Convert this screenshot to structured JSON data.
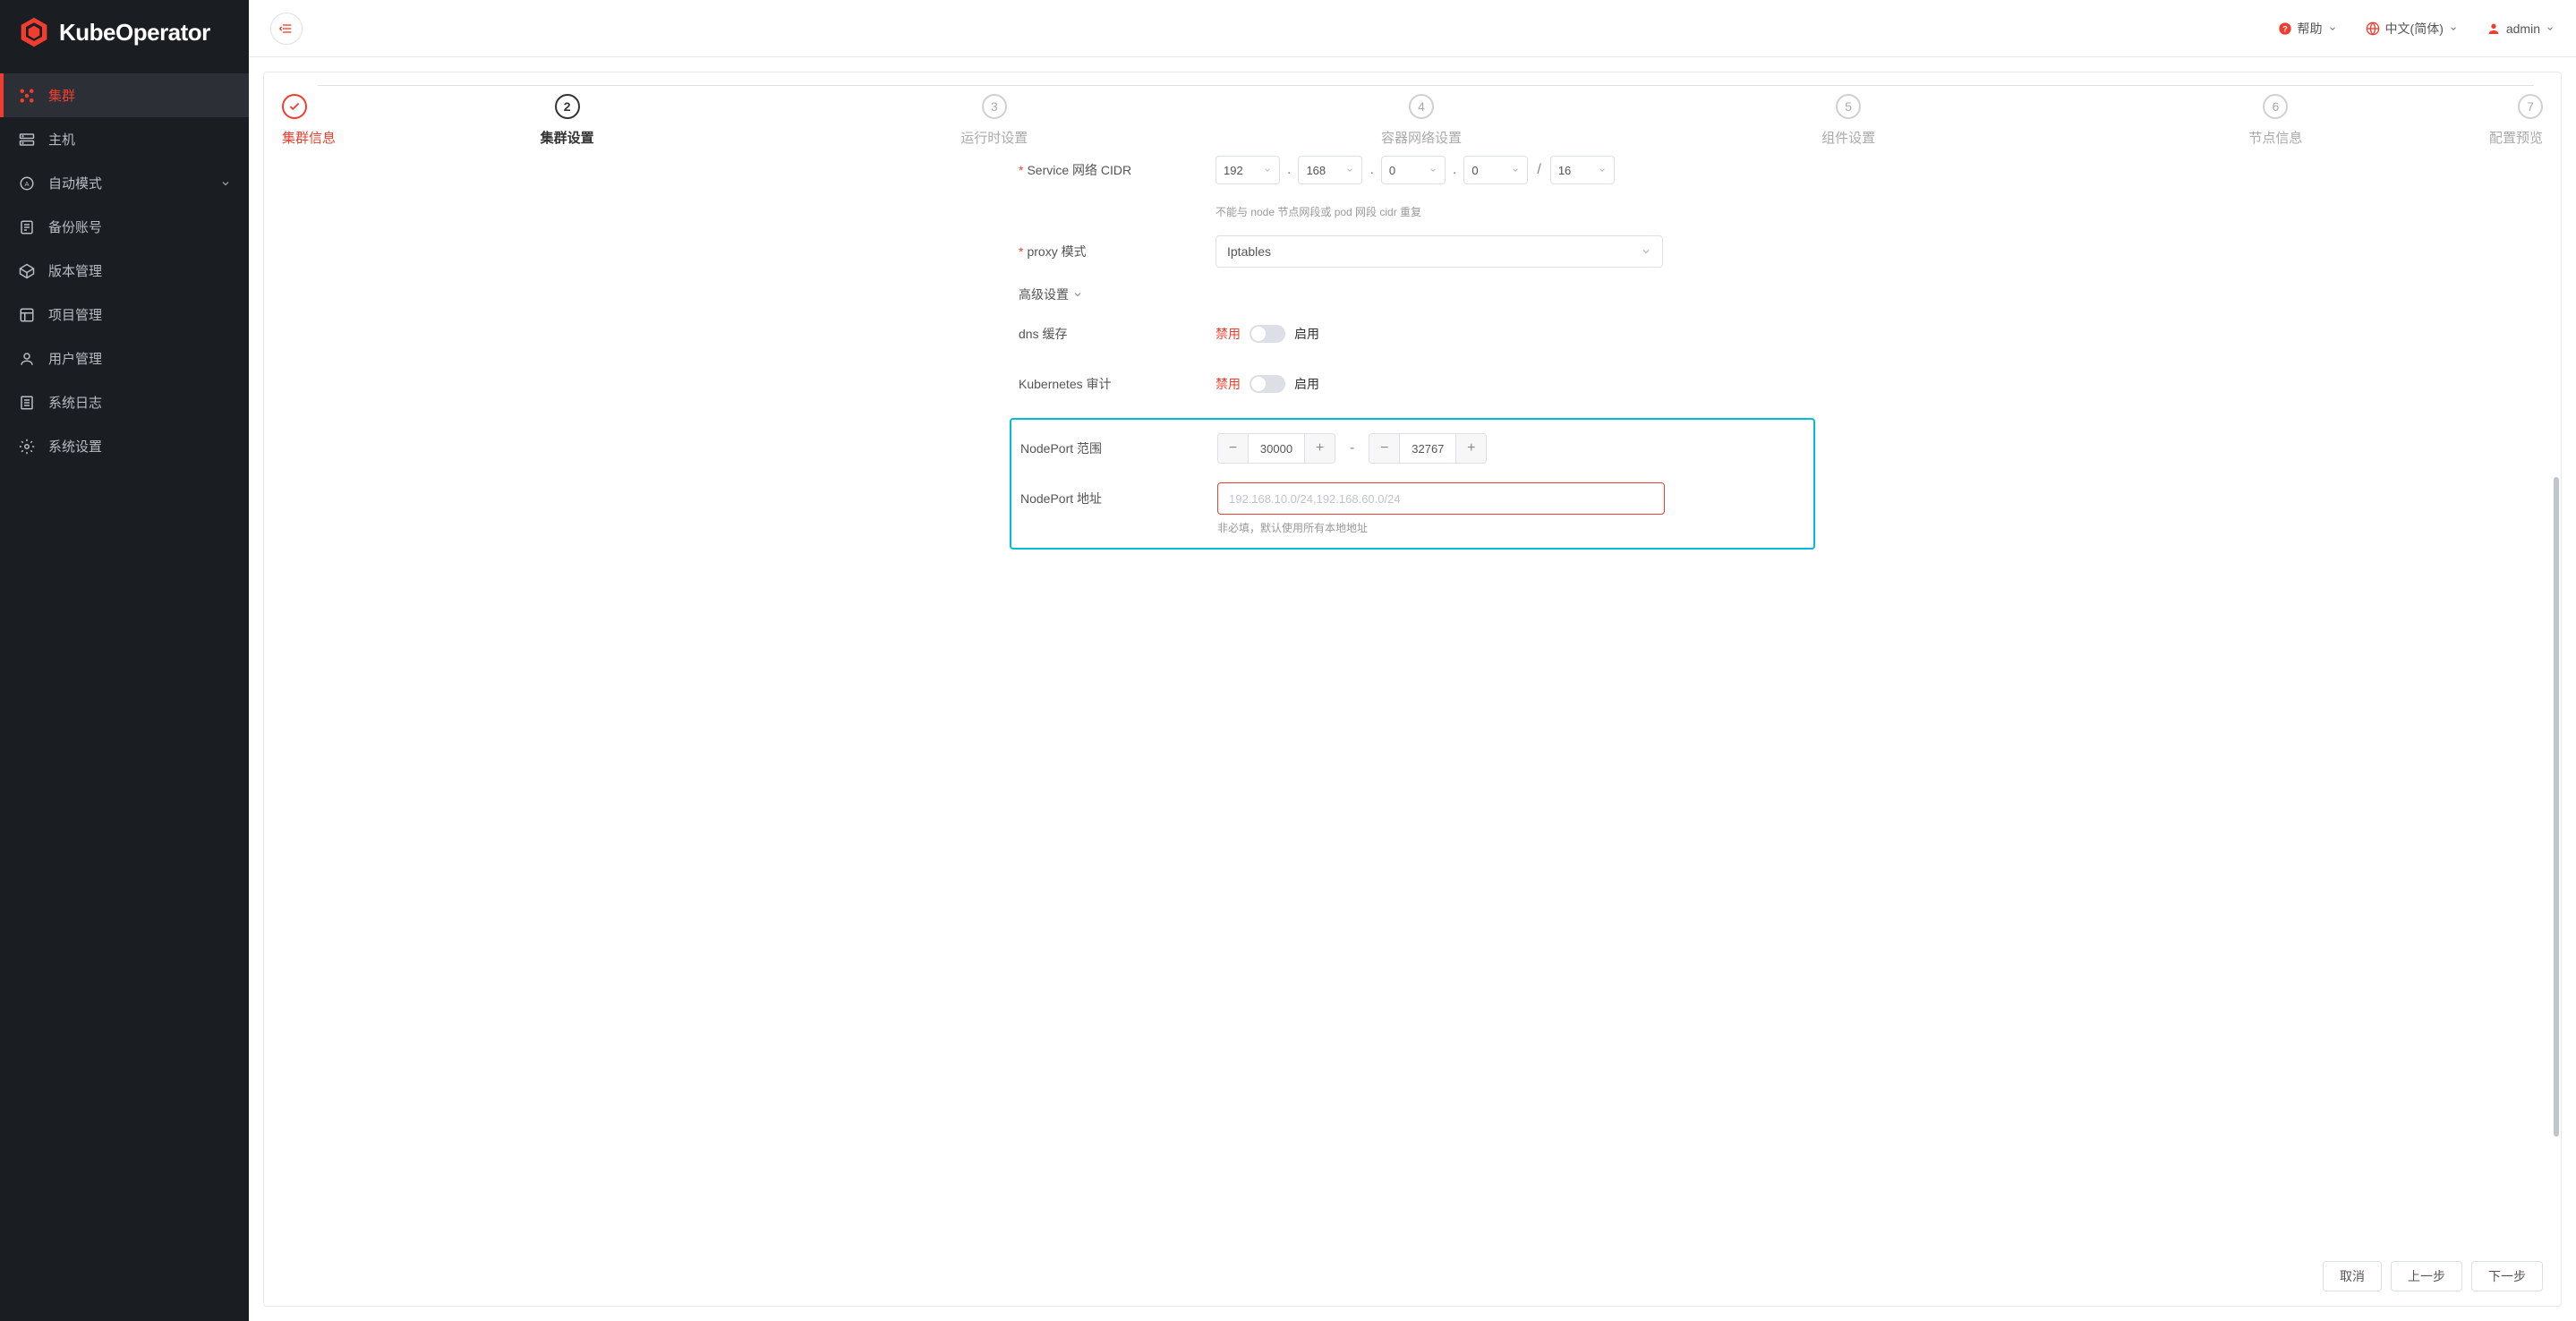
{
  "brand": "KubeOperator",
  "header": {
    "help": "帮助",
    "lang": "中文(简体)",
    "user": "admin"
  },
  "sidebar": {
    "items": [
      {
        "label": "集群",
        "icon": "cluster"
      },
      {
        "label": "主机",
        "icon": "host"
      },
      {
        "label": "自动模式",
        "icon": "auto",
        "expandable": true
      },
      {
        "label": "备份账号",
        "icon": "backup"
      },
      {
        "label": "版本管理",
        "icon": "version"
      },
      {
        "label": "项目管理",
        "icon": "project"
      },
      {
        "label": "用户管理",
        "icon": "user"
      },
      {
        "label": "系统日志",
        "icon": "log"
      },
      {
        "label": "系统设置",
        "icon": "settings"
      }
    ]
  },
  "steps": [
    {
      "label": "集群信息",
      "state": "done"
    },
    {
      "label": "集群设置",
      "state": "active",
      "num": "2"
    },
    {
      "label": "运行时设置",
      "state": "todo",
      "num": "3"
    },
    {
      "label": "容器网络设置",
      "state": "todo",
      "num": "4"
    },
    {
      "label": "组件设置",
      "state": "todo",
      "num": "5"
    },
    {
      "label": "节点信息",
      "state": "todo",
      "num": "6"
    },
    {
      "label": "配置预览",
      "state": "todo",
      "num": "7"
    }
  ],
  "form": {
    "service_cidr": {
      "label": "Service 网络 CIDR",
      "ip": [
        "192",
        "168",
        "0",
        "0"
      ],
      "mask": "16",
      "hint": "不能与 node 节点网段或 pod 网段 cidr 重复"
    },
    "proxy_mode": {
      "label": "proxy 模式",
      "value": "Iptables"
    },
    "advanced": "高级设置",
    "dns_cache": {
      "label": "dns 缓存",
      "off": "禁用",
      "on": "启用"
    },
    "k8s_audit": {
      "label": "Kubernetes 审计",
      "off": "禁用",
      "on": "启用"
    },
    "nodeport_range": {
      "label": "NodePort 范围",
      "from": "30000",
      "to": "32767"
    },
    "nodeport_addr": {
      "label": "NodePort 地址",
      "placeholder": "192.168.10.0/24,192.168.60.0/24",
      "hint": "非必填，默认使用所有本地地址"
    }
  },
  "footer": {
    "cancel": "取消",
    "prev": "上一步",
    "next": "下一步"
  }
}
